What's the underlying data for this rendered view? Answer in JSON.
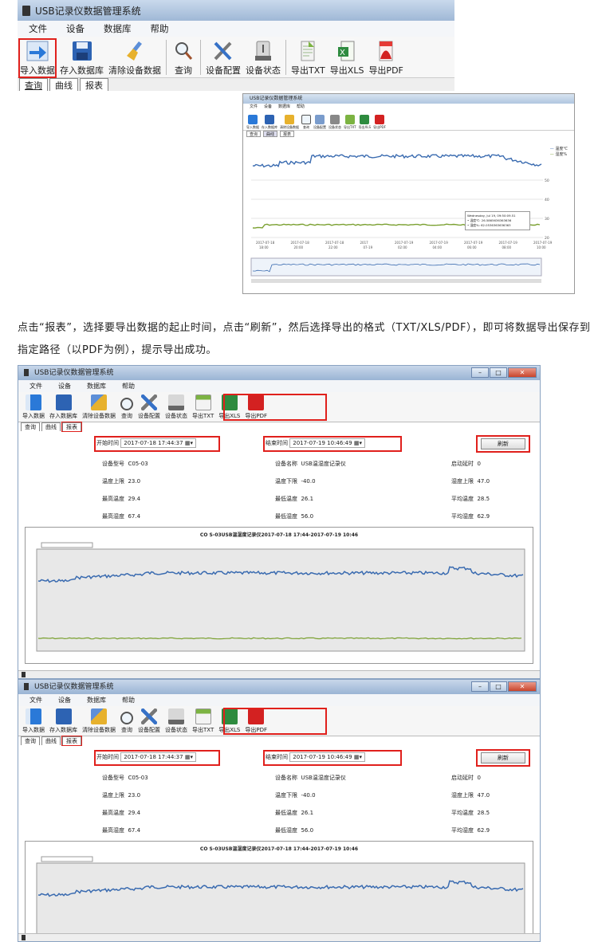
{
  "app_title": "USB记录仪数据管理系统",
  "menu": [
    "文件",
    "设备",
    "数据库",
    "帮助"
  ],
  "toolbar": {
    "import": "导入数据",
    "store": "存入数据库",
    "clear": "清除设备数据",
    "query": "查询",
    "config": "设备配置",
    "status": "设备状态",
    "export_txt": "导出TXT",
    "export_xls": "导出XLS",
    "export_pdf": "导出PDF"
  },
  "tabs": [
    "查询",
    "曲线",
    "报表"
  ],
  "mini": {
    "legend": [
      "温度℃",
      "湿度%"
    ],
    "tooltip_lines": [
      "Wednesday, Jul 19, 09:50:09.51",
      "• 温度℃: 26.5865636363636",
      "• 湿度%: 62.0536363636363"
    ],
    "x_ticks": [
      "2017-07-18 18:00",
      "2017-07-18 20:00",
      "2017-07-18 22:00",
      "2017 07-19",
      "2017-07-19 02:00",
      "2017-07-19 04:00",
      "2017-07-19 06:00",
      "2017-07-19 08:00",
      "2017-07-19 10:00"
    ],
    "y_ticks": [
      "50",
      "40",
      "30",
      "20"
    ]
  },
  "paragraph": "点击“报表”，选择要导出数据的起止时间，点击“刷新”，然后选择导出的格式（TXT/XLS/PDF），即可将数据导出保存到指定路径（以PDF为例），提示导出成功。",
  "report": {
    "start_label": "开始时间",
    "start_value": "2017-07-18 17:44:37",
    "end_label": "结束时间",
    "end_value": "2017-07-19 10:46:49",
    "refresh": "刷新",
    "device_model_label": "设备型号",
    "device_model": "C05-03",
    "device_name_label": "设备名称",
    "device_name": "USB温湿度记录仪",
    "start_delay_label": "启动延时",
    "start_delay": "0",
    "temp_upper_label": "温度上限",
    "temp_upper": "23.0",
    "temp_lower_label": "温度下限",
    "temp_lower": "-40.0",
    "humid_upper_label": "湿度上限",
    "humid_upper": "47.0",
    "max_temp_label": "最高温度",
    "max_temp": "29.4",
    "min_temp_label": "最低温度",
    "min_temp": "26.1",
    "avg_temp_label": "平均温度",
    "avg_temp": "28.5",
    "max_humid_label": "最高湿度",
    "max_humid": "67.4",
    "min_humid_label": "最低湿度",
    "min_humid": "56.0",
    "avg_humid_label": "平均湿度",
    "avg_humid": "62.9",
    "chart_title": "CO S-03USB温湿度记录仪2017-07-18 17:44-2017-07-19 10:46"
  },
  "colors": {
    "highlight": "#e0201c",
    "temp_line": "#3a6bb0",
    "humid_line": "#7aa030"
  }
}
